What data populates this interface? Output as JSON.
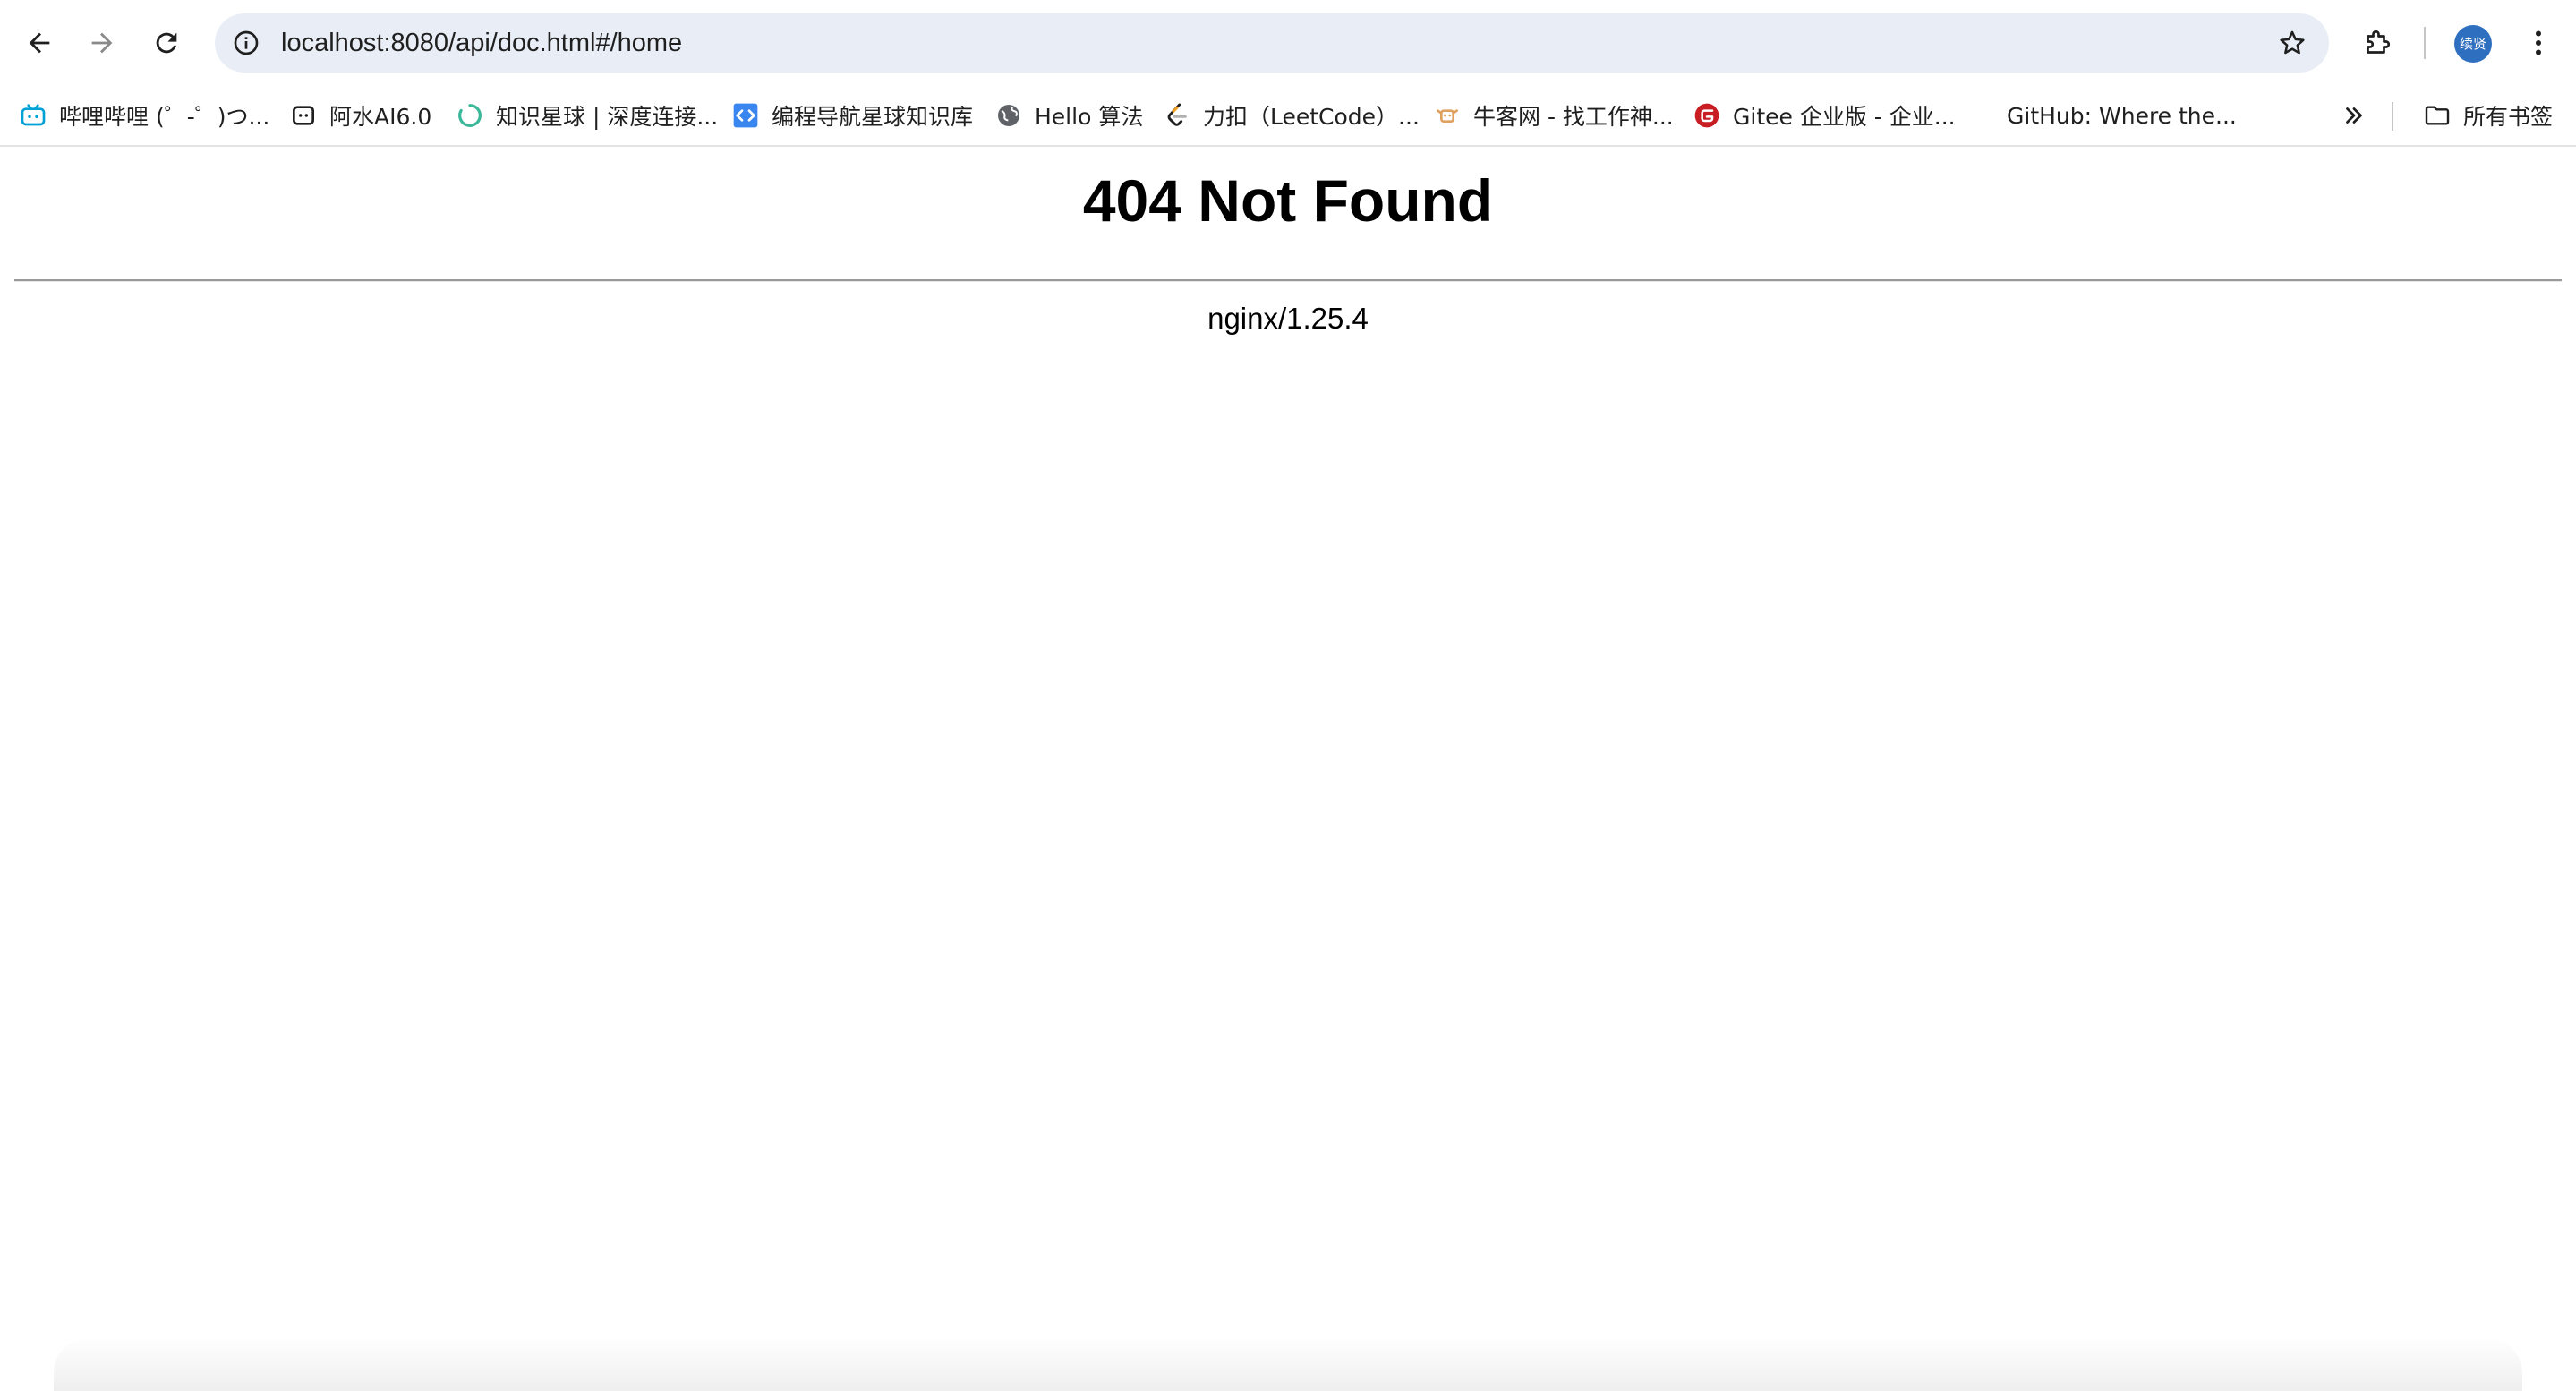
{
  "browser": {
    "address_bar": {
      "url": "localhost:8080/api/doc.html#/home"
    },
    "profile": {
      "avatar_text": "续贤",
      "avatar_color": "#2f6fbf"
    },
    "bookmarks": [
      {
        "label": "哔哩哔哩 (゜-゜)つ...",
        "icon": "bilibili-icon"
      },
      {
        "label": "阿水AI6.0",
        "icon": "robot-icon"
      },
      {
        "label": "知识星球 | 深度连接...",
        "icon": "zsxq-icon"
      },
      {
        "label": "编程导航星球知识库",
        "icon": "code-nav-icon"
      },
      {
        "label": "Hello 算法",
        "icon": "globe-icon"
      },
      {
        "label": "力扣（LeetCode）...",
        "icon": "leetcode-icon"
      },
      {
        "label": "牛客网 - 找工作神...",
        "icon": "nowcoder-icon"
      },
      {
        "label": "Gitee 企业版 - 企业...",
        "icon": "gitee-icon"
      },
      {
        "label": "GitHub: Where the...",
        "icon": "github-icon"
      }
    ],
    "all_bookmarks_label": "所有书签"
  },
  "page": {
    "title": "404 Not Found",
    "server": "nginx/1.25.4"
  }
}
